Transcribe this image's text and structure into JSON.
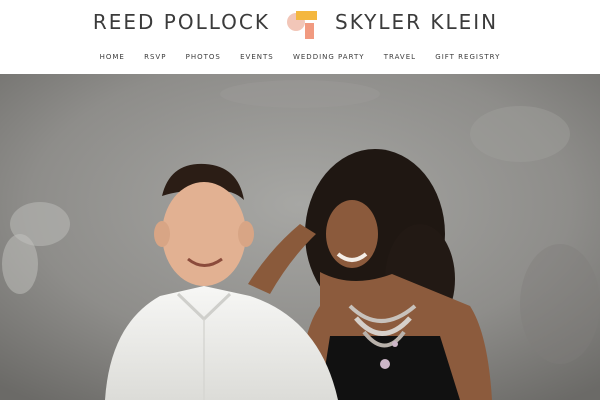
{
  "header": {
    "left_name": "REED POLLOCK",
    "right_name": "SKYLER KLEIN",
    "logo_icon": "abstract-shapes-logo",
    "colors": {
      "peach": "#f2c6b8",
      "yellow": "#f4b73f",
      "coral": "#f19a80",
      "text": "#3b3b3b"
    }
  },
  "nav": {
    "items": [
      {
        "label": "HOME"
      },
      {
        "label": "RSVP"
      },
      {
        "label": "PHOTOS"
      },
      {
        "label": "EVENTS"
      },
      {
        "label": "WEDDING PARTY"
      },
      {
        "label": "TRAVEL"
      },
      {
        "label": "GIFT REGISTRY"
      }
    ]
  },
  "hero": {
    "subject": "couple-photo"
  }
}
